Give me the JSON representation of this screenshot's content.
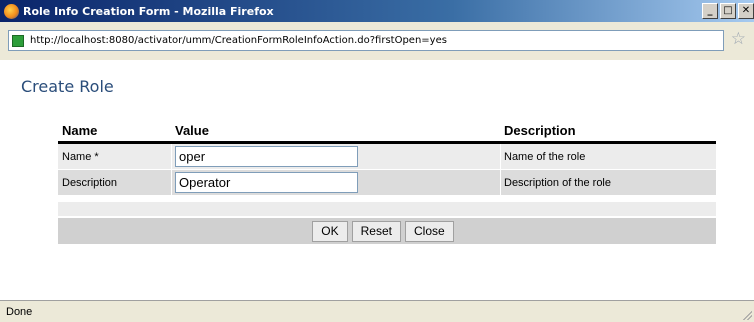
{
  "window": {
    "title": "Role Info Creation Form - Mozilla Firefox",
    "buttons": {
      "minimize": "_",
      "maximize": "□",
      "close": "✕"
    }
  },
  "address_bar": {
    "url": "http://localhost:8080/activator/umm/CreationFormRoleInfoAction.do?firstOpen=yes",
    "icons": {
      "site": "site-favicon",
      "bookmark": "star-icon"
    }
  },
  "page": {
    "title": "Create Role"
  },
  "table": {
    "headers": {
      "name": "Name",
      "value": "Value",
      "description": "Description"
    },
    "rows": [
      {
        "label": "Name *",
        "value": "oper",
        "description": "Name of the role"
      },
      {
        "label": "Description",
        "value": "Operator",
        "description": "Description of the role"
      }
    ]
  },
  "buttons": {
    "ok": "OK",
    "reset": "Reset",
    "close": "Close"
  },
  "status_bar": {
    "text": "Done"
  },
  "colors": {
    "titlebar": "#0a246a",
    "heading": "#2a4d7a",
    "row_light": "#ececec",
    "row_dark": "#dcdcdc"
  }
}
